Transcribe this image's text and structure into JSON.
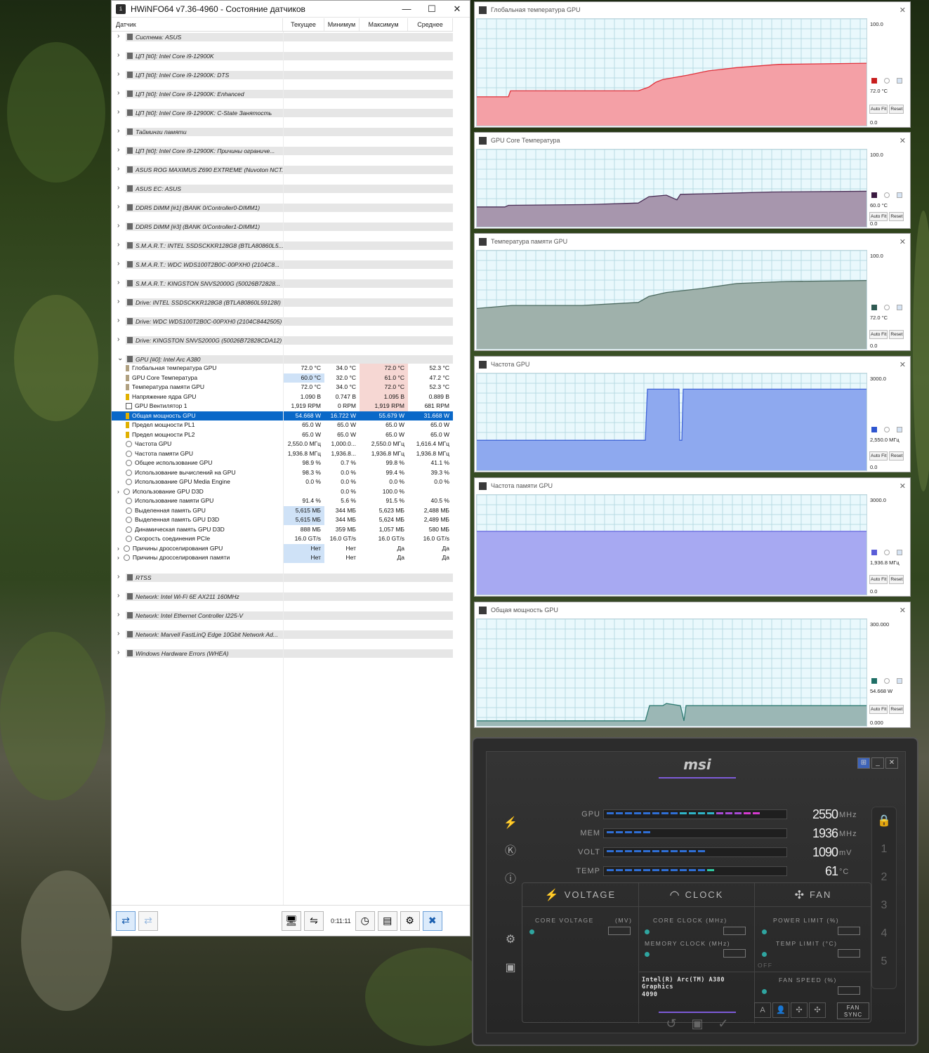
{
  "hwinfo": {
    "title": "HWiNFO64 v7.36-4960 - Состояние датчиков",
    "columns": [
      "Датчик",
      "Текущее",
      "Минимум",
      "Максимум",
      "Среднее"
    ],
    "groups_top": [
      "Система: ASUS",
      "ЦП [#0]: Intel Core i9-12900K",
      "ЦП [#0]: Intel Core i9-12900K: DTS",
      "ЦП [#0]: Intel Core i9-12900K: Enhanced",
      "ЦП [#0]: Intel Core i9-12900K: C-State Занятость",
      "Тайминги памяти",
      "ЦП [#0]: Intel Core i9-12900K: Причины ограниче...",
      "ASUS ROG MAXIMUS Z690 EXTREME (Nuvoton NCT...",
      "ASUS EC: ASUS",
      "DDR5 DIMM [#1] (BANK 0/Controller0-DIMM1)",
      "DDR5 DIMM [#3] (BANK 0/Controller1-DIMM1)",
      "S.M.A.R.T.: INTEL SSDSCKKR128G8 (BTLA80860L5...",
      "S.M.A.R.T.: WDC WDS100T2B0C-00PXH0 (2104C8...",
      "S.M.A.R.T.: KINGSTON SNVS2000G (50026B72828...",
      "Drive: INTEL SSDSCKKR128G8 (BTLA80860L59128I)",
      "Drive: WDC WDS100T2B0C-00PXH0 (2104C8442505)",
      "Drive: KINGSTON SNVS2000G (50026B72828CDA12)"
    ],
    "gpu_group": "GPU [#0]: Intel Arc A380",
    "rows": [
      {
        "name": "Глобальная температура GPU",
        "cur": "72.0 °C",
        "min": "34.0 °C",
        "max": "72.0 °C",
        "avg": "52.3 °C",
        "icon": "thermometer"
      },
      {
        "name": "GPU Core Температура",
        "cur": "60.0 °C",
        "min": "32.0 °C",
        "max": "61.0 °C",
        "avg": "47.2 °C",
        "icon": "thermometer"
      },
      {
        "name": "Температура памяти GPU",
        "cur": "72.0 °C",
        "min": "34.0 °C",
        "max": "72.0 °C",
        "avg": "52.3 °C",
        "icon": "thermometer"
      },
      {
        "name": "Напряжение ядра GPU",
        "cur": "1.090 В",
        "min": "0.747 В",
        "max": "1.095 В",
        "avg": "0.889 В",
        "icon": "bolt"
      },
      {
        "name": "GPU Вентилятор 1",
        "cur": "1,919 RPM",
        "min": "0 RPM",
        "max": "1,919 RPM",
        "avg": "681 RPM",
        "icon": "fan"
      },
      {
        "name": "Общая мощность GPU",
        "cur": "54.668 W",
        "min": "16.722 W",
        "max": "55.679 W",
        "avg": "31.668 W",
        "icon": "bolt"
      },
      {
        "name": "Предел мощности PL1",
        "cur": "65.0 W",
        "min": "65.0 W",
        "max": "65.0 W",
        "avg": "65.0 W",
        "icon": "bolt"
      },
      {
        "name": "Предел мощности PL2",
        "cur": "65.0 W",
        "min": "65.0 W",
        "max": "65.0 W",
        "avg": "65.0 W",
        "icon": "bolt"
      },
      {
        "name": "Частота GPU",
        "cur": "2,550.0 МГц",
        "min": "1,000.0...",
        "max": "2,550.0 МГц",
        "avg": "1,616.4 МГц",
        "icon": "clock"
      },
      {
        "name": "Частота памяти GPU",
        "cur": "1,936.8 МГц",
        "min": "1,936.8...",
        "max": "1,936.8 МГц",
        "avg": "1,936.8 МГц",
        "icon": "clock"
      },
      {
        "name": "Общее использование GPU",
        "cur": "98.9 %",
        "min": "0.7 %",
        "max": "99.8 %",
        "avg": "41.1 %",
        "icon": "clock"
      },
      {
        "name": "Использование вычислений на GPU",
        "cur": "98.3 %",
        "min": "0.0 %",
        "max": "99.4 %",
        "avg": "39.3 %",
        "icon": "clock"
      },
      {
        "name": "Использование GPU Media Engine",
        "cur": "0.0 %",
        "min": "0.0 %",
        "max": "0.0 %",
        "avg": "0.0 %",
        "icon": "clock"
      },
      {
        "name": "Использование GPU D3D",
        "cur": "",
        "min": "0.0 %",
        "max": "100.0 %",
        "avg": "",
        "icon": "clock",
        "sub": true
      },
      {
        "name": "Использование памяти GPU",
        "cur": "91.4 %",
        "min": "5.6 %",
        "max": "91.5 %",
        "avg": "40.5 %",
        "icon": "clock"
      },
      {
        "name": "Выделенная память GPU",
        "cur": "5,615 МБ",
        "min": "344 МБ",
        "max": "5,623 МБ",
        "avg": "2,488 МБ",
        "icon": "clock"
      },
      {
        "name": "Выделенная память GPU D3D",
        "cur": "5,615 МБ",
        "min": "344 МБ",
        "max": "5,624 МБ",
        "avg": "2,489 МБ",
        "icon": "clock"
      },
      {
        "name": "Динамическая память GPU D3D",
        "cur": "888 МБ",
        "min": "359 МБ",
        "max": "1,057 МБ",
        "avg": "580 МБ",
        "icon": "clock"
      },
      {
        "name": "Скорость соединения PCIe",
        "cur": "16.0 GT/s",
        "min": "16.0 GT/s",
        "max": "16.0 GT/s",
        "avg": "16.0 GT/s",
        "icon": "clock"
      },
      {
        "name": "Причины дросселирования GPU",
        "cur": "Нет",
        "min": "Нет",
        "max": "Да",
        "avg": "Да",
        "icon": "clock",
        "sub": true
      },
      {
        "name": "Причины дросселирования памяти",
        "cur": "Нет",
        "min": "Нет",
        "max": "Да",
        "avg": "Да",
        "icon": "clock",
        "sub": true
      }
    ],
    "groups_bottom": [
      "RTSS",
      "Network: Intel Wi-Fi 6E AX211 160MHz",
      "Network: Intel Ethernet Controller I225-V",
      "Network: Marvell FastLinQ Edge 10Gbit Network Ad...",
      "Windows Hardware Errors (WHEA)"
    ],
    "elapsed": "0:11:11"
  },
  "graphs": [
    {
      "title": "Глобальная температура GPU",
      "max": "100.0",
      "current": "72.0 °C",
      "min": "0.0",
      "color": "#f4a0a6",
      "line": "#e0303a",
      "swatch": "#c81e1e"
    },
    {
      "title": "GPU Core Температура",
      "max": "100.0",
      "current": "60.0 °C",
      "min": "0.0",
      "color": "#a796ad",
      "line": "#4a2d55",
      "swatch": "#3a1a40"
    },
    {
      "title": "Температура памяти GPU",
      "max": "100.0",
      "current": "72.0 °C",
      "min": "0.0",
      "color": "#9fb1ab",
      "line": "#4c6a60",
      "swatch": "#2f5a52"
    },
    {
      "title": "Частота GPU",
      "max": "3000.0",
      "current": "2,550.0 МГц",
      "min": "0.0",
      "color": "#8ea9ef",
      "line": "#3f63d8",
      "swatch": "#2f56d0"
    },
    {
      "title": "Частота памяти GPU",
      "max": "3000.0",
      "current": "1,936.8 МГц",
      "min": "0.0",
      "color": "#a7a9f2",
      "line": "#6c6fe0",
      "swatch": "#5a5dd8"
    },
    {
      "title": "Общая мощность GPU",
      "max": "300.000",
      "current": "54.668 W",
      "min": "0.000",
      "color": "#9bb7b5",
      "line": "#2f7b72",
      "swatch": "#1f6f66"
    }
  ],
  "graph_buttons": {
    "autofit": "Auto Fit",
    "reset": "Reset"
  },
  "msi": {
    "logo": "msi",
    "monitor": [
      {
        "label": "GPU",
        "value": "2550",
        "unit": "MHz",
        "fill": 0.83,
        "color": "grad-gpu"
      },
      {
        "label": "MEM",
        "value": "1936",
        "unit": "MHz",
        "fill": 0.27,
        "color": "#2f6fd6"
      },
      {
        "label": "VOLT",
        "value": "1090",
        "unit": "mV",
        "fill": 0.55,
        "color": "#2f6fd6"
      },
      {
        "label": "TEMP",
        "value": "61",
        "unit": "°C",
        "fill": 0.61,
        "color": "grad-temp"
      }
    ],
    "sections": {
      "voltage": "VOLTAGE",
      "clock": "CLOCK",
      "fan": "FAN"
    },
    "labels": {
      "core_voltage": "CORE VOLTAGE",
      "core_voltage_unit": "(MV)",
      "core_clock": "CORE CLOCK (MHz)",
      "memory_clock": "MEMORY CLOCK (MHz)",
      "power_limit": "POWER LIMIT (%)",
      "temp_limit": "TEMP LIMIT (°C)",
      "fan_speed": "FAN SPEED (%)",
      "off": "OFF",
      "fan_sync": "FAN SYNC"
    },
    "gpu_name": "Intel(R) Arc(TM) A380 Graphics",
    "driver": "4090",
    "profiles": [
      "1",
      "2",
      "3",
      "4",
      "5"
    ]
  }
}
